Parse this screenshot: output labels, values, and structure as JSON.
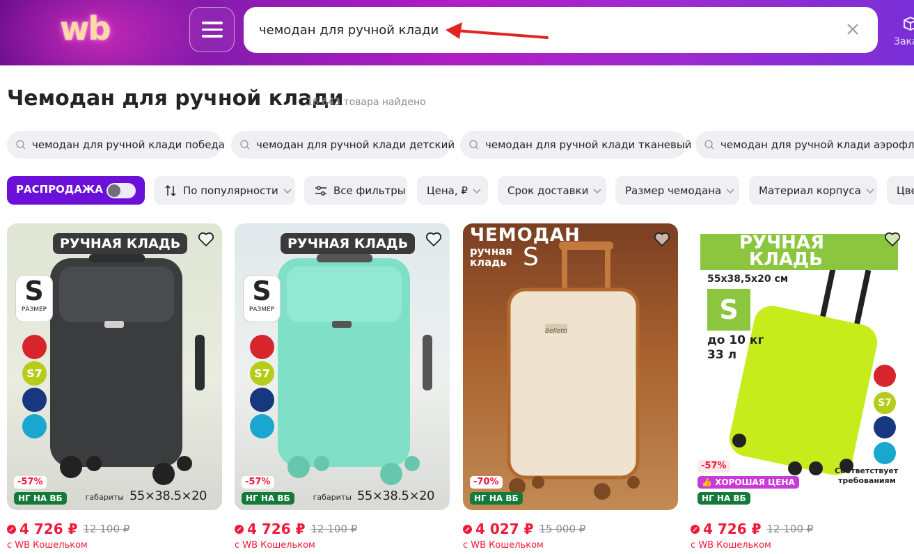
{
  "header": {
    "logo": "wb",
    "search_value": "чемодан для ручной клади",
    "orders_label": "Зака"
  },
  "page": {
    "title": "Чемодан для ручной клади",
    "found": "16 643 товара найдено"
  },
  "suggestions": [
    "чемодан для ручной клади победа",
    "чемодан для ручной клади детский",
    "чемодан для ручной клади тканевый",
    "чемодан для ручной клади аэрофлот"
  ],
  "filters": {
    "sale_label": "РАСПРОДАЖА",
    "sale_enabled": false,
    "sort": "По популярности",
    "all": "Все фильтры",
    "price": "Цена, ₽",
    "delivery": "Срок доставки",
    "size": "Размер чемодана",
    "material": "Материал корпуса",
    "color": "Цве"
  },
  "products": [
    {
      "banner": "РУЧНАЯ КЛАДЬ",
      "size_letter": "S",
      "size_caption": "РАЗМЕР",
      "discount": "-57%",
      "promo": "НГ НА ВБ",
      "dims_label": "габариты",
      "dims_value": "55×38.5×20",
      "price": "4 726 ₽",
      "old_price": "12 100 ₽",
      "wallet": "с WB Кошельком",
      "body_color": "#3b3c3e"
    },
    {
      "banner": "РУЧНАЯ КЛАДЬ",
      "size_letter": "S",
      "size_caption": "РАЗМЕР",
      "discount": "-57%",
      "promo": "НГ НА ВБ",
      "dims_label": "габариты",
      "dims_value": "55×38.5×20",
      "price": "4 726 ₽",
      "old_price": "12 100 ₽",
      "wallet": "с WB Кошельком",
      "body_color": "#7fe0c7"
    },
    {
      "banner_1": "ЧЕМОДАН",
      "banner_2a": "ручная",
      "banner_2b": "кладь",
      "size_letter": "S",
      "brand": "Belletti",
      "discount": "-70%",
      "promo": "НГ НА ВБ",
      "price": "4 027 ₽",
      "old_price": "15 000 ₽",
      "wallet": "с WB Кошельком",
      "body_color": "#efe3cf"
    },
    {
      "banner_1": "РУЧНАЯ",
      "banner_2": "КЛАДЬ",
      "dims": "55x38,5x20 см",
      "size_letter": "S",
      "weight": "до 10 кг",
      "volume": "33 л",
      "compliance_1": "Соответствует",
      "compliance_2": "требованиям",
      "discount": "-57%",
      "good_price": "ХОРОШАЯ ЦЕНА",
      "promo": "НГ НА ВБ",
      "price": "4 726 ₽",
      "old_price": "12 100 ₽",
      "wallet": "с WB Кошельком",
      "body_color": "#c6ec1c"
    }
  ],
  "airline_logos": [
    "ural-airlines",
    "s7",
    "aeroflot",
    "azimuth"
  ],
  "s7_text": "S7",
  "colors": {
    "accent": "#6b10d8",
    "price_red": "#f2183b",
    "promo_green": "#137a3a",
    "lime_banner": "#8cc63f"
  }
}
